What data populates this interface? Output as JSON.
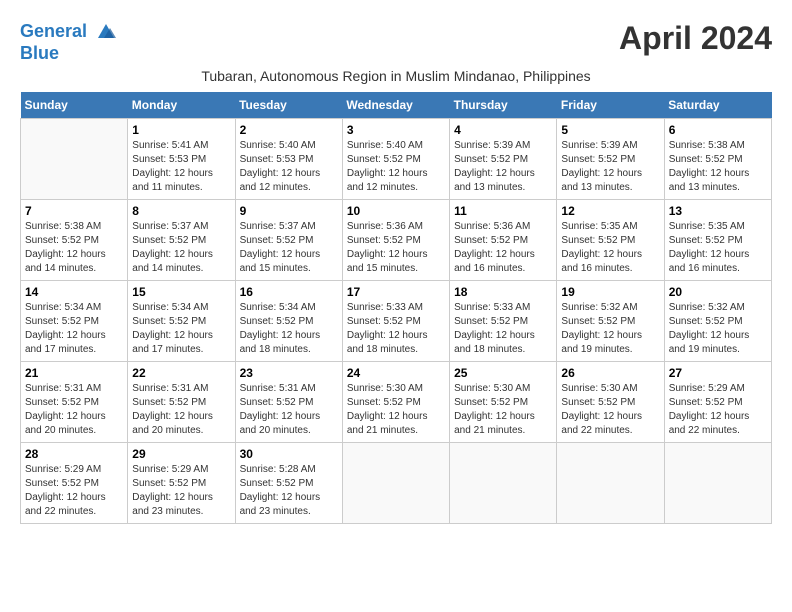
{
  "header": {
    "logo_line1": "General",
    "logo_line2": "Blue",
    "month_title": "April 2024",
    "subtitle": "Tubaran, Autonomous Region in Muslim Mindanao, Philippines"
  },
  "weekdays": [
    "Sunday",
    "Monday",
    "Tuesday",
    "Wednesday",
    "Thursday",
    "Friday",
    "Saturday"
  ],
  "weeks": [
    [
      {
        "day": "",
        "sunrise": "",
        "sunset": "",
        "daylight": ""
      },
      {
        "day": "1",
        "sunrise": "Sunrise: 5:41 AM",
        "sunset": "Sunset: 5:53 PM",
        "daylight": "Daylight: 12 hours and 11 minutes."
      },
      {
        "day": "2",
        "sunrise": "Sunrise: 5:40 AM",
        "sunset": "Sunset: 5:53 PM",
        "daylight": "Daylight: 12 hours and 12 minutes."
      },
      {
        "day": "3",
        "sunrise": "Sunrise: 5:40 AM",
        "sunset": "Sunset: 5:52 PM",
        "daylight": "Daylight: 12 hours and 12 minutes."
      },
      {
        "day": "4",
        "sunrise": "Sunrise: 5:39 AM",
        "sunset": "Sunset: 5:52 PM",
        "daylight": "Daylight: 12 hours and 13 minutes."
      },
      {
        "day": "5",
        "sunrise": "Sunrise: 5:39 AM",
        "sunset": "Sunset: 5:52 PM",
        "daylight": "Daylight: 12 hours and 13 minutes."
      },
      {
        "day": "6",
        "sunrise": "Sunrise: 5:38 AM",
        "sunset": "Sunset: 5:52 PM",
        "daylight": "Daylight: 12 hours and 13 minutes."
      }
    ],
    [
      {
        "day": "7",
        "sunrise": "Sunrise: 5:38 AM",
        "sunset": "Sunset: 5:52 PM",
        "daylight": "Daylight: 12 hours and 14 minutes."
      },
      {
        "day": "8",
        "sunrise": "Sunrise: 5:37 AM",
        "sunset": "Sunset: 5:52 PM",
        "daylight": "Daylight: 12 hours and 14 minutes."
      },
      {
        "day": "9",
        "sunrise": "Sunrise: 5:37 AM",
        "sunset": "Sunset: 5:52 PM",
        "daylight": "Daylight: 12 hours and 15 minutes."
      },
      {
        "day": "10",
        "sunrise": "Sunrise: 5:36 AM",
        "sunset": "Sunset: 5:52 PM",
        "daylight": "Daylight: 12 hours and 15 minutes."
      },
      {
        "day": "11",
        "sunrise": "Sunrise: 5:36 AM",
        "sunset": "Sunset: 5:52 PM",
        "daylight": "Daylight: 12 hours and 16 minutes."
      },
      {
        "day": "12",
        "sunrise": "Sunrise: 5:35 AM",
        "sunset": "Sunset: 5:52 PM",
        "daylight": "Daylight: 12 hours and 16 minutes."
      },
      {
        "day": "13",
        "sunrise": "Sunrise: 5:35 AM",
        "sunset": "Sunset: 5:52 PM",
        "daylight": "Daylight: 12 hours and 16 minutes."
      }
    ],
    [
      {
        "day": "14",
        "sunrise": "Sunrise: 5:34 AM",
        "sunset": "Sunset: 5:52 PM",
        "daylight": "Daylight: 12 hours and 17 minutes."
      },
      {
        "day": "15",
        "sunrise": "Sunrise: 5:34 AM",
        "sunset": "Sunset: 5:52 PM",
        "daylight": "Daylight: 12 hours and 17 minutes."
      },
      {
        "day": "16",
        "sunrise": "Sunrise: 5:34 AM",
        "sunset": "Sunset: 5:52 PM",
        "daylight": "Daylight: 12 hours and 18 minutes."
      },
      {
        "day": "17",
        "sunrise": "Sunrise: 5:33 AM",
        "sunset": "Sunset: 5:52 PM",
        "daylight": "Daylight: 12 hours and 18 minutes."
      },
      {
        "day": "18",
        "sunrise": "Sunrise: 5:33 AM",
        "sunset": "Sunset: 5:52 PM",
        "daylight": "Daylight: 12 hours and 18 minutes."
      },
      {
        "day": "19",
        "sunrise": "Sunrise: 5:32 AM",
        "sunset": "Sunset: 5:52 PM",
        "daylight": "Daylight: 12 hours and 19 minutes."
      },
      {
        "day": "20",
        "sunrise": "Sunrise: 5:32 AM",
        "sunset": "Sunset: 5:52 PM",
        "daylight": "Daylight: 12 hours and 19 minutes."
      }
    ],
    [
      {
        "day": "21",
        "sunrise": "Sunrise: 5:31 AM",
        "sunset": "Sunset: 5:52 PM",
        "daylight": "Daylight: 12 hours and 20 minutes."
      },
      {
        "day": "22",
        "sunrise": "Sunrise: 5:31 AM",
        "sunset": "Sunset: 5:52 PM",
        "daylight": "Daylight: 12 hours and 20 minutes."
      },
      {
        "day": "23",
        "sunrise": "Sunrise: 5:31 AM",
        "sunset": "Sunset: 5:52 PM",
        "daylight": "Daylight: 12 hours and 20 minutes."
      },
      {
        "day": "24",
        "sunrise": "Sunrise: 5:30 AM",
        "sunset": "Sunset: 5:52 PM",
        "daylight": "Daylight: 12 hours and 21 minutes."
      },
      {
        "day": "25",
        "sunrise": "Sunrise: 5:30 AM",
        "sunset": "Sunset: 5:52 PM",
        "daylight": "Daylight: 12 hours and 21 minutes."
      },
      {
        "day": "26",
        "sunrise": "Sunrise: 5:30 AM",
        "sunset": "Sunset: 5:52 PM",
        "daylight": "Daylight: 12 hours and 22 minutes."
      },
      {
        "day": "27",
        "sunrise": "Sunrise: 5:29 AM",
        "sunset": "Sunset: 5:52 PM",
        "daylight": "Daylight: 12 hours and 22 minutes."
      }
    ],
    [
      {
        "day": "28",
        "sunrise": "Sunrise: 5:29 AM",
        "sunset": "Sunset: 5:52 PM",
        "daylight": "Daylight: 12 hours and 22 minutes."
      },
      {
        "day": "29",
        "sunrise": "Sunrise: 5:29 AM",
        "sunset": "Sunset: 5:52 PM",
        "daylight": "Daylight: 12 hours and 23 minutes."
      },
      {
        "day": "30",
        "sunrise": "Sunrise: 5:28 AM",
        "sunset": "Sunset: 5:52 PM",
        "daylight": "Daylight: 12 hours and 23 minutes."
      },
      {
        "day": "",
        "sunrise": "",
        "sunset": "",
        "daylight": ""
      },
      {
        "day": "",
        "sunrise": "",
        "sunset": "",
        "daylight": ""
      },
      {
        "day": "",
        "sunrise": "",
        "sunset": "",
        "daylight": ""
      },
      {
        "day": "",
        "sunrise": "",
        "sunset": "",
        "daylight": ""
      }
    ]
  ]
}
